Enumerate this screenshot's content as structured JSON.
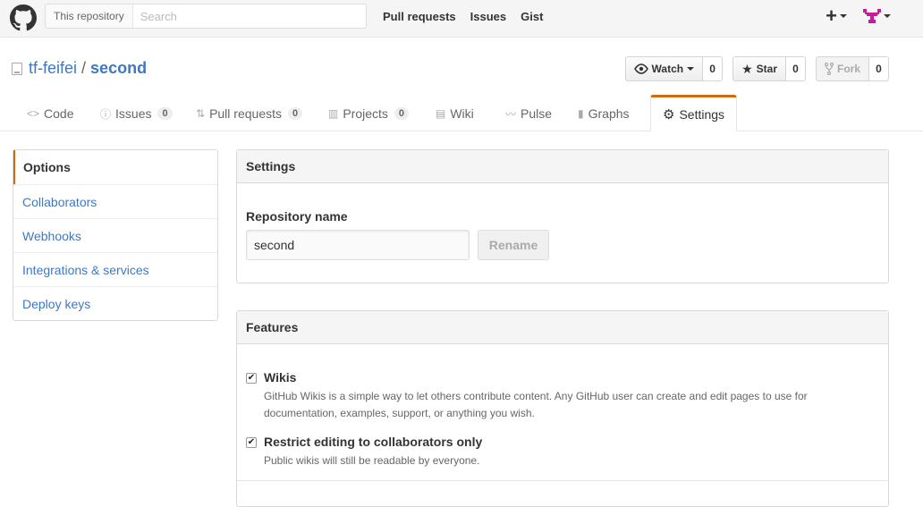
{
  "header": {
    "search_scope": "This repository",
    "search_placeholder": "Search",
    "nav": [
      "Pull requests",
      "Issues",
      "Gist"
    ]
  },
  "repo": {
    "owner": "tf-feifei",
    "separator": "/",
    "name": "second",
    "watch_label": "Watch",
    "watch_count": "0",
    "star_label": "Star",
    "star_count": "0",
    "fork_label": "Fork",
    "fork_count": "0"
  },
  "tabs": {
    "code": "Code",
    "issues": "Issues",
    "issues_count": "0",
    "pulls": "Pull requests",
    "pulls_count": "0",
    "projects": "Projects",
    "projects_count": "0",
    "wiki": "Wiki",
    "pulse": "Pulse",
    "graphs": "Graphs",
    "settings": "Settings"
  },
  "menu": [
    "Options",
    "Collaborators",
    "Webhooks",
    "Integrations & services",
    "Deploy keys"
  ],
  "settings_box": {
    "title": "Settings",
    "repo_name_label": "Repository name",
    "repo_name_value": "second",
    "rename_label": "Rename"
  },
  "features_box": {
    "title": "Features",
    "wikis_title": "Wikis",
    "wikis_desc": "GitHub Wikis is a simple way to let others contribute content. Any GitHub user can create and edit pages to use for documentation, examples, support, or anything you wish.",
    "restrict_title": "Restrict editing to collaborators only",
    "restrict_desc": "Public wikis will still be readable by everyone."
  },
  "colors": {
    "link": "#4078c0",
    "accent": "#d26911",
    "avatar": "#c9199e"
  }
}
